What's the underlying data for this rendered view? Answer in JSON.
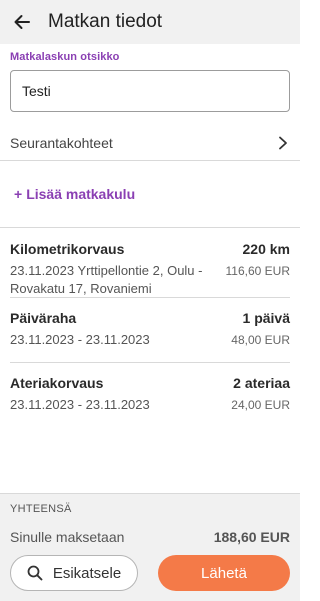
{
  "header": {
    "title": "Matkan tiedot",
    "back_icon": "arrow-left-icon"
  },
  "title_field": {
    "label": "Matkalaskun otsikko",
    "value": "Testi"
  },
  "tracking": {
    "label": "Seurantakohteet",
    "icon": "chevron-right-icon"
  },
  "add_expense": {
    "plus": "+",
    "label": "Lisää matkakulu"
  },
  "expenses": [
    {
      "title": "Kilometrikorvaus",
      "quantity": "220 km",
      "description": "23.11.2023 Yrttipellontie 2, Oulu - Rovakatu 17, Rovaniemi",
      "amount": "116,60 EUR"
    },
    {
      "title": "Päiväraha",
      "quantity": "1 päivä",
      "description": "23.11.2023 - 23.11.2023",
      "amount": "48,00 EUR"
    },
    {
      "title": "Ateriakorvaus",
      "quantity": "2 ateriaa",
      "description": "23.11.2023 - 23.11.2023",
      "amount": "24,00 EUR"
    }
  ],
  "footer": {
    "total_heading": "YHTEENSÄ",
    "payable_label": "Sinulle maksetaan",
    "payable_value": "188,60 EUR",
    "preview_label": "Esikatsele",
    "preview_icon": "search-icon",
    "send_label": "Lähetä"
  },
  "colors": {
    "accent": "#8a3fb3",
    "send_button": "#f47a48",
    "header_bg": "#f1f1f1"
  }
}
